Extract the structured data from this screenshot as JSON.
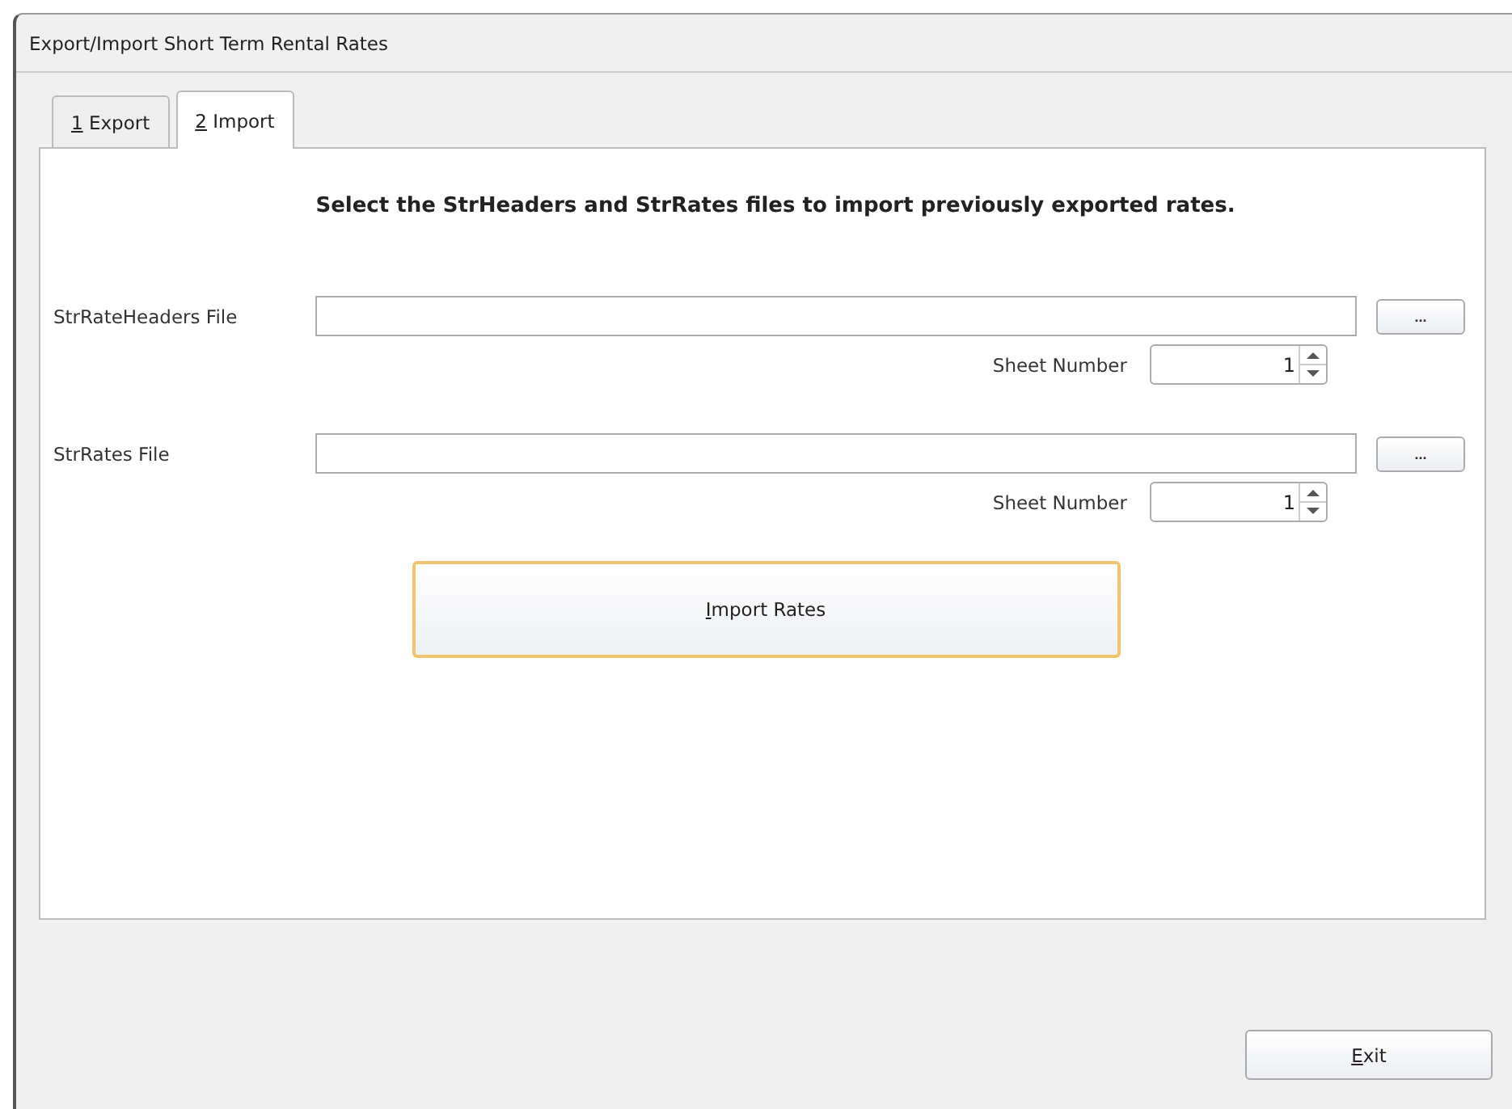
{
  "window": {
    "title": "Export/Import Short Term Rental Rates"
  },
  "tabs": [
    {
      "mnemonic": "1",
      "rest": " Export",
      "selected": false
    },
    {
      "mnemonic": "2",
      "rest": " Import",
      "selected": true
    }
  ],
  "instruction": "Select the StrHeaders and StrRates files to import previously exported rates.",
  "file_groups": [
    {
      "label": "StrRateHeaders File",
      "browse": "...",
      "sheet_label": "Sheet Number",
      "sheet_value": "1"
    },
    {
      "label": "StrRates File",
      "browse": "...",
      "sheet_label": "Sheet Number",
      "sheet_value": "1"
    }
  ],
  "import_button": {
    "mnemonic": "I",
    "rest": "mport Rates"
  },
  "exit_button": {
    "mnemonic": "E",
    "rest": "xit"
  }
}
